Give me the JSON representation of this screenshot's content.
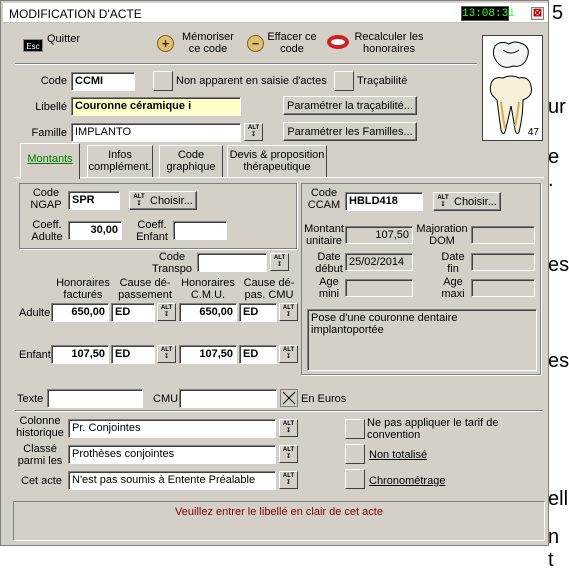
{
  "window": {
    "title": "MODIFICATION D'ACTE",
    "clock": "13:08:31",
    "close_symbol": "⊠"
  },
  "toolbar": {
    "quitter": "Quitter",
    "quitter_key": "Esc",
    "memoriser": "Mémoriser ce code",
    "effacer": "Effacer ce code",
    "recalculer": "Recalculer les honoraires"
  },
  "tooth": {
    "number": "47"
  },
  "acte": {
    "code_label": "Code",
    "code_value": "CCMI",
    "non_apparent_label": "Non apparent en saisie d'actes",
    "tracabilite_label": "Traçabilité",
    "libelle_label": "Libellé",
    "libelle_value": "Couronne céramique i",
    "parametrer_tracabilite": "Paramétrer la traçabilité...",
    "famille_label": "Famille",
    "famille_value": "IMPLANTO",
    "parametrer_familles": "Paramétrer les Familles..."
  },
  "tabs": [
    {
      "label": "Montants"
    },
    {
      "label": "Infos complément."
    },
    {
      "label": "Code graphique"
    },
    {
      "label": "Devis & proposition thérapeutique"
    }
  ],
  "ngap": {
    "code_label": "Code NGAP",
    "code_value": "SPR",
    "choisir": "Choisir...",
    "coeff_adulte_label": "Coeff. Adulte",
    "coeff_adulte_value": "30,00",
    "coeff_enfant_label": "Coeff. Enfant",
    "coeff_enfant_value": ""
  },
  "ccam": {
    "code_label": "Code CCAM",
    "code_value": "HBLD418",
    "choisir": "Choisir...",
    "montant_label": "Montant unitaire",
    "montant_value": "107,50",
    "majoration_label": "Majoration DOM",
    "majoration_value": "",
    "date_debut_label": "Date début",
    "date_debut_value": "25/02/2014",
    "date_fin_label": "Date fin",
    "date_fin_value": "",
    "age_mini_label": "Age mini",
    "age_mini_value": "",
    "age_maxi_label": "Age maxi",
    "age_maxi_value": "",
    "description": "Pose d'une couronne dentaire implantoportée"
  },
  "honoraires": {
    "code_transpo_label": "Code Transpo",
    "code_transpo_value": "",
    "col_hon_factures": "Honoraires facturés",
    "col_cause_dep": "Cause dé- passement",
    "col_hon_cmu": "Honoraires C.M.U.",
    "col_cause_dep_cmu": "Cause dé- pas. CMU",
    "adulte_label": "Adulte",
    "adulte_hon": "650,00",
    "adulte_cause": "ED",
    "adulte_cmu": "650,00",
    "adulte_cause_cmu": "ED",
    "enfant_label": "Enfant",
    "enfant_hon": "107,50",
    "enfant_cause": "ED",
    "enfant_cmu": "107,50",
    "enfant_cause_cmu": "ED"
  },
  "texte": {
    "texte_label": "Texte",
    "texte_value": "",
    "cmu_label": "CMU",
    "cmu_value": "",
    "en_euros_label": "En Euros"
  },
  "bottom": {
    "colonne_label": "Colonne historique",
    "colonne_value": "Pr. Conjointes",
    "classe_label": "Classé parmi les",
    "classe_value": "Prothèses conjointes",
    "cet_acte_label": "Cet acte",
    "cet_acte_value": "N'est pas soumis à Entente Préalable",
    "ne_pas_appliquer": "Ne pas appliquer le tarif de convention",
    "non_totalise": "Non totalisé",
    "chronometrage": "Chronométrage"
  },
  "status": {
    "message": "Veuillez entrer le libellé en clair de cet acte"
  },
  "alt_glyph": "ALT ↧",
  "background_doc": {
    "t1": "5",
    "t2": "ur",
    "t3": "e .",
    "t4": "es",
    "t5": "es",
    "t6": "ell",
    "t7": "n t"
  }
}
